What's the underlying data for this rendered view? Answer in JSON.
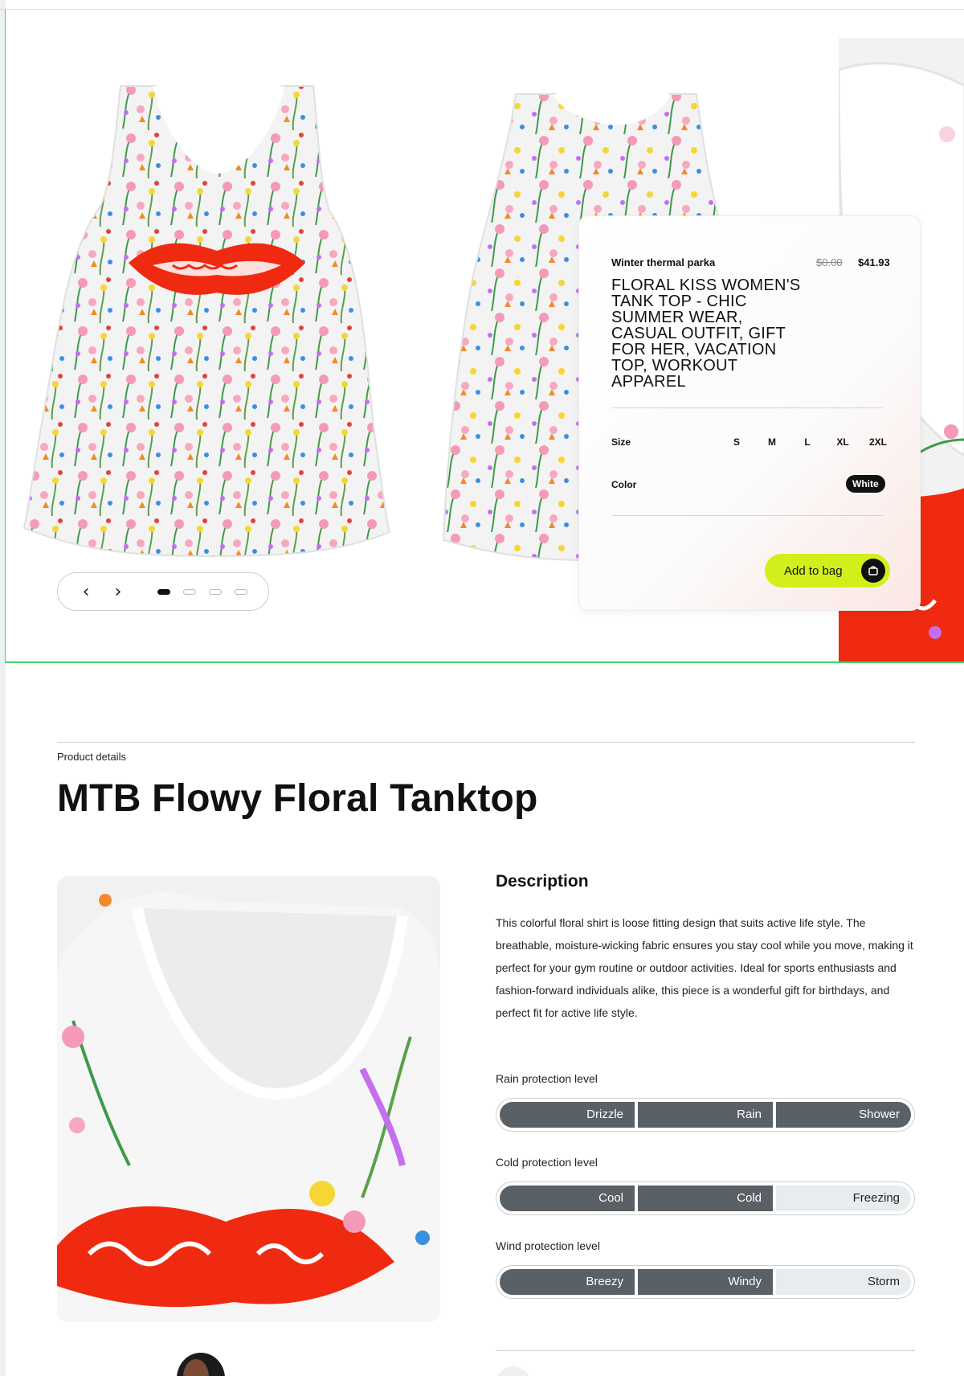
{
  "product_card": {
    "subtitle": "Winter thermal parka",
    "price_old": "$0.00",
    "price_new": "$41.93",
    "title": "FLORAL KISS WOMEN'S TANK TOP - CHIC SUMMER WEAR, CASUAL OUTFIT, GIFT FOR HER, VACATION TOP, WORKOUT APPAREL",
    "size_label": "Size",
    "sizes": [
      "S",
      "M",
      "L",
      "XL",
      "2XL"
    ],
    "color_label": "Color",
    "color_value": "White",
    "add_to_bag": "Add to bag"
  },
  "carousel": {
    "prev_icon": "chevron-left-icon",
    "next_icon": "chevron-right-icon",
    "prev_glyph": "‹",
    "next_glyph": "›",
    "slides": 4,
    "active_slide": 1
  },
  "details": {
    "label": "Product details",
    "title": "MTB Flowy Floral Tanktop",
    "description_heading": "Description",
    "description": "This colorful floral shirt is loose fitting design that suits active life style. The breathable, moisture-wicking fabric ensures you stay cool while you move, making it perfect for your gym routine or outdoor activities. Ideal for sports enthusiasts and fashion-forward individuals alike, this piece is a wonderful gift for birthdays, and perfect fit for active life style."
  },
  "protection": [
    {
      "label": "Rain protection level",
      "levels": [
        "Drizzle",
        "Rain",
        "Shower"
      ],
      "active_count": 3
    },
    {
      "label": "Cold protection level",
      "levels": [
        "Cool",
        "Cold",
        "Freezing"
      ],
      "active_count": 2
    },
    {
      "label": "Wind protection level",
      "levels": [
        "Breezy",
        "Windy",
        "Storm"
      ],
      "active_count": 2
    }
  ],
  "colors": {
    "accent_button": "#d2ef1c",
    "segment_active": "#596066",
    "segment_inactive": "#e9ecee",
    "lips_red": "#ef2a10",
    "hero_border": "#42d36b"
  }
}
